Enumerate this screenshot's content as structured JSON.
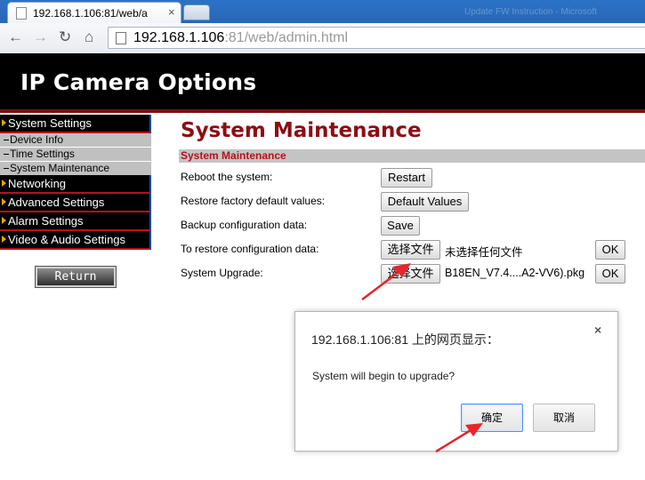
{
  "browser": {
    "tab_title": "192.168.1.106:81/web/a",
    "tab_close": "×",
    "ghost_tab": "Update FW Instruction - Microsoft",
    "url_host": "192.168.1.106",
    "url_rest": ":81/web/admin.html"
  },
  "header": {
    "title": "IP Camera Options"
  },
  "sidebar": {
    "items": [
      {
        "label": "System Settings"
      },
      {
        "label": "Networking"
      },
      {
        "label": "Advanced Settings"
      },
      {
        "label": "Alarm Settings"
      },
      {
        "label": "Video & Audio Settings"
      }
    ],
    "subitems": [
      {
        "label": "Device Info"
      },
      {
        "label": "Time Settings"
      },
      {
        "label": "System Maintenance"
      }
    ],
    "return_label": "Return"
  },
  "main": {
    "title": "System Maintenance",
    "section": "System Maintenance",
    "rows": [
      {
        "label": "Reboot the system:",
        "button": "Restart"
      },
      {
        "label": "Restore factory default values:",
        "button": "Default Values"
      },
      {
        "label": "Backup configuration data:",
        "button": "Save"
      },
      {
        "label": "To restore configuration data:",
        "button": "选择文件",
        "status": "未选择任何文件",
        "ok": "OK"
      },
      {
        "label": "System Upgrade:",
        "button": "选择文件",
        "status": "B18EN_V7.4....A2-VV6).pkg",
        "ok": "OK"
      }
    ]
  },
  "dialog": {
    "title": "192.168.1.106:81 上的网页显示：",
    "close": "×",
    "message": "System will begin to upgrade?",
    "ok": "确定",
    "cancel": "取消"
  },
  "colors": {
    "title_red": "#8b0f14",
    "section_red": "#b5121b",
    "arrow_red": "#e8252b",
    "tab_blue": "#2a66b5"
  }
}
